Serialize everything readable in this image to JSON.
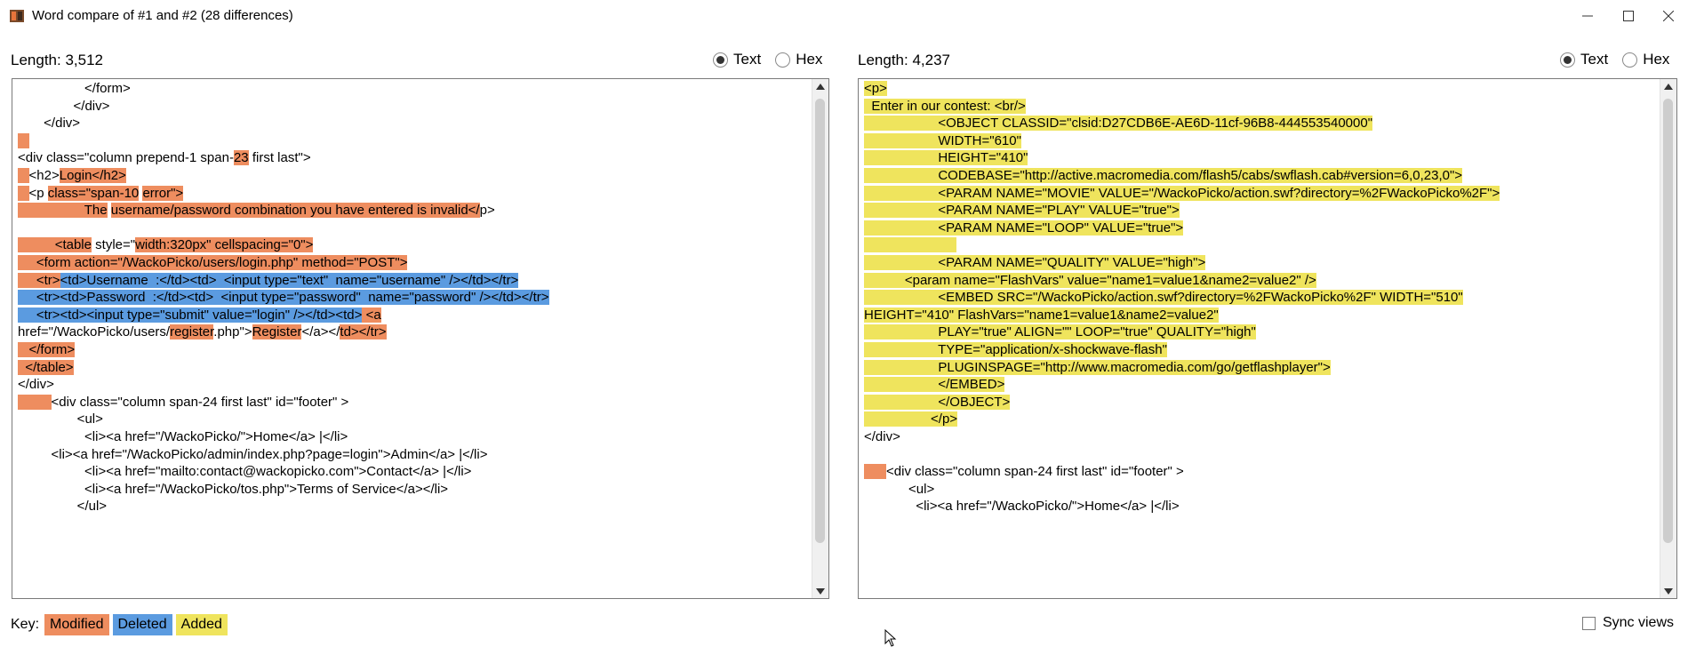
{
  "window": {
    "title": "Word compare of #1 and #2  (28 differences)"
  },
  "left": {
    "length_label": "Length: 3,512",
    "radio_text": "Text",
    "radio_hex": "Hex",
    "lines": [
      [
        {
          "t": "                  </form>"
        }
      ],
      [
        {
          "t": "               </div>"
        }
      ],
      [
        {
          "t": "       </div>"
        }
      ],
      [
        {
          "t": "   ",
          "c": "mod"
        }
      ],
      [
        {
          "t": "<div class=\"column prepend-1 span-"
        },
        {
          "t": "23",
          "c": "mod"
        },
        {
          "t": " first last\">"
        }
      ],
      [
        {
          "t": "   ",
          "c": "mod"
        },
        {
          "t": "<h2>"
        },
        {
          "t": "Login</h2>",
          "c": "mod"
        }
      ],
      [
        {
          "t": "   ",
          "c": "mod"
        },
        {
          "t": "<p "
        },
        {
          "t": "class=\"span-10",
          "c": "mod"
        },
        {
          "t": " "
        },
        {
          "t": "error\">",
          "c": "mod"
        }
      ],
      [
        {
          "t": "                  ",
          "c": "mod"
        },
        {
          "t": "The",
          "c": "mod"
        },
        {
          "t": " "
        },
        {
          "t": "username/password combination you have entered is invalid</",
          "c": "mod"
        },
        {
          "t": "p>"
        }
      ],
      [
        {
          "t": ""
        }
      ],
      [
        {
          "t": "          ",
          "c": "mod"
        },
        {
          "t": "<table",
          "c": "mod"
        },
        {
          "t": " style=\""
        },
        {
          "t": "width",
          "c": "mod"
        },
        {
          "t": ":320px\" cellspacing=\"0\">",
          "c": "mod"
        }
      ],
      [
        {
          "t": "     ",
          "c": "mod"
        },
        {
          "t": "<form action=\"/WackoPicko/users/login.php\" method=\"POST\">",
          "c": "mod"
        }
      ],
      [
        {
          "t": "     ",
          "c": "mod"
        },
        {
          "t": "<tr>",
          "c": "mod"
        },
        {
          "t": "<td>Username  :</td><td>  <input type=\"text\"  name=\"username\" /></td></tr>",
          "c": "del"
        }
      ],
      [
        {
          "t": "     <tr><td>Password  :</td><td>  <input type=\"password\"  name=\"password\" /></td></tr>",
          "c": "del"
        }
      ],
      [
        {
          "t": "     <tr><td><input type=\"submit\" value=\"login\" /></td><td>",
          "c": "del"
        },
        {
          "t": " <a",
          "c": "mod"
        }
      ],
      [
        {
          "t": "href=\"/WackoPicko/users/"
        },
        {
          "t": "register",
          "c": "mod"
        },
        {
          "t": ".php\">"
        },
        {
          "t": "Register",
          "c": "mod"
        },
        {
          "t": "</a></"
        },
        {
          "t": "td></tr>",
          "c": "mod"
        }
      ],
      [
        {
          "t": "   </form>",
          "c": "mod"
        }
      ],
      [
        {
          "t": "  </table>",
          "c": "mod"
        }
      ],
      [
        {
          "t": "</div>"
        }
      ],
      [
        {
          "t": "         ",
          "c": "mod"
        },
        {
          "t": "<div class=\"column span-24 first last\" id=\"footer\" >"
        }
      ],
      [
        {
          "t": "                <ul>"
        }
      ],
      [
        {
          "t": "                  <li><a href=\"/WackoPicko/\">Home</a> |</li>"
        }
      ],
      [
        {
          "t": "         <li><a href=\"/WackoPicko/admin/index.php?page=login\">Admin</a> |</li>"
        }
      ],
      [
        {
          "t": "                  <li><a href=\"mailto:contact@wackopicko.com\">Contact</a> |</li>"
        }
      ],
      [
        {
          "t": "                  <li><a href=\"/WackoPicko/tos.php\">Terms of Service</a></li>"
        }
      ],
      [
        {
          "t": "                </ul>"
        }
      ]
    ]
  },
  "right": {
    "length_label": "Length: 4,237",
    "radio_text": "Text",
    "radio_hex": "Hex",
    "lines": [
      [
        {
          "t": "<p>",
          "c": "add"
        }
      ],
      [
        {
          "t": "  Enter in our contest: <br/>",
          "c": "add"
        }
      ],
      [
        {
          "t": "                    <OBJECT CLASSID=\"clsid:D27CDB6E-AE6D-11cf-96B8-444553540000\"",
          "c": "add"
        }
      ],
      [
        {
          "t": "                    WIDTH=\"610\"",
          "c": "add"
        }
      ],
      [
        {
          "t": "                    HEIGHT=\"410\"",
          "c": "add"
        }
      ],
      [
        {
          "t": "                    CODEBASE=\"http://active.macromedia.com/flash5/cabs/swflash.cab#version=6,0,23,0\">",
          "c": "add"
        }
      ],
      [
        {
          "t": "                    <PARAM NAME=\"MOVIE\" VALUE=\"/WackoPicko/action.swf?directory=%2FWackoPicko%2F\">",
          "c": "add"
        }
      ],
      [
        {
          "t": "                    <PARAM NAME=\"PLAY\" VALUE=\"true\">",
          "c": "add"
        }
      ],
      [
        {
          "t": "                    <PARAM NAME=\"LOOP\" VALUE=\"true\">",
          "c": "add"
        }
      ],
      [
        {
          "t": "                         ",
          "c": "add"
        }
      ],
      [
        {
          "t": "                    <PARAM NAME=\"QUALITY\" VALUE=\"high\">",
          "c": "add"
        }
      ],
      [
        {
          "t": "           ",
          "c": "add"
        },
        {
          "t": "<param name=\"FlashVars\" value=\"name1=value1&name2=value2\" />",
          "c": "add"
        }
      ],
      [
        {
          "t": "                    <EMBED SRC=\"/WackoPicko/action.swf?directory=%2FWackoPicko%2F\" WIDTH=\"510\"",
          "c": "add"
        }
      ],
      [
        {
          "t": "HEIGHT=\"410\" FlashVars=\"name1=value1&name2=value2\"",
          "c": "add"
        }
      ],
      [
        {
          "t": "                    PLAY=\"true\" ALIGN=\"\" LOOP=\"true\" QUALITY=\"high\"",
          "c": "add"
        }
      ],
      [
        {
          "t": "                    TYPE=\"application/x-shockwave-flash\"",
          "c": "add"
        }
      ],
      [
        {
          "t": "                    PLUGINSPAGE=\"http://www.macromedia.com/go/getflashplayer\">",
          "c": "add"
        }
      ],
      [
        {
          "t": "                    </EMBED>",
          "c": "add"
        }
      ],
      [
        {
          "t": "                    </OBJECT>",
          "c": "add"
        }
      ],
      [
        {
          "t": "                  </p>",
          "c": "add"
        }
      ],
      [
        {
          "t": "</div>"
        }
      ],
      [
        {
          "t": ""
        }
      ],
      [
        {
          "t": "      ",
          "c": "mod"
        },
        {
          "t": "<div class=\"column span-24 first last\" id=\"footer\" >"
        }
      ],
      [
        {
          "t": "            <ul>"
        }
      ],
      [
        {
          "t": "              <li><a href=\"/WackoPicko/\">Home</a> |</li>"
        }
      ]
    ]
  },
  "footer": {
    "key_label": "Key:",
    "key_modified": "Modified",
    "key_deleted": "Deleted",
    "key_added": "Added",
    "sync_label": "Sync views"
  }
}
